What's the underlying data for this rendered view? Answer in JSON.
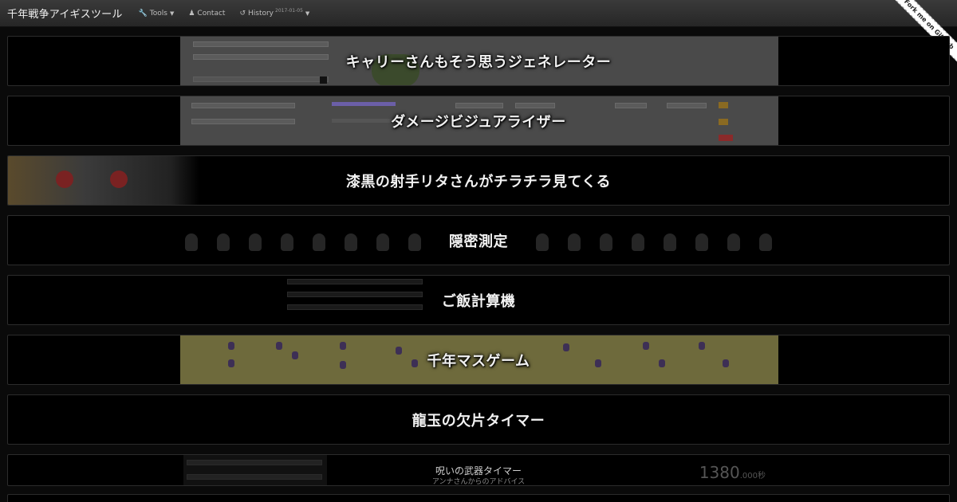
{
  "navbar": {
    "brand": "千年戦争アイギスツール",
    "tools_label": "Tools",
    "contact_label": "Contact",
    "history_label": "History",
    "history_date": "2017-01-05"
  },
  "ribbon": {
    "label": "Fork me on GitHub"
  },
  "tools": [
    {
      "title": "キャリーさんもそう思うジェネレーター"
    },
    {
      "title": "ダメージビジュアライザー"
    },
    {
      "title": "漆黒の射手リタさんがチラチラ見てくる"
    },
    {
      "title": "隠密測定"
    },
    {
      "title": "ご飯計算機"
    },
    {
      "title": "千年マスゲーム"
    },
    {
      "title": "龍玉の欠片タイマー"
    }
  ],
  "cursed_panel": {
    "title": "呪いの武器タイマー",
    "subtitle": "アンナさんからのアドバイス",
    "value": "1380",
    "value_suffix": ".000秒"
  },
  "colors": {
    "background": "#0a0a0a",
    "panel": "#000000",
    "navbar": "#2f2f2f",
    "title_text": "#f2f2f2"
  },
  "icons": {
    "tools": "wrench-icon",
    "contact": "user-icon",
    "history": "history-icon"
  }
}
